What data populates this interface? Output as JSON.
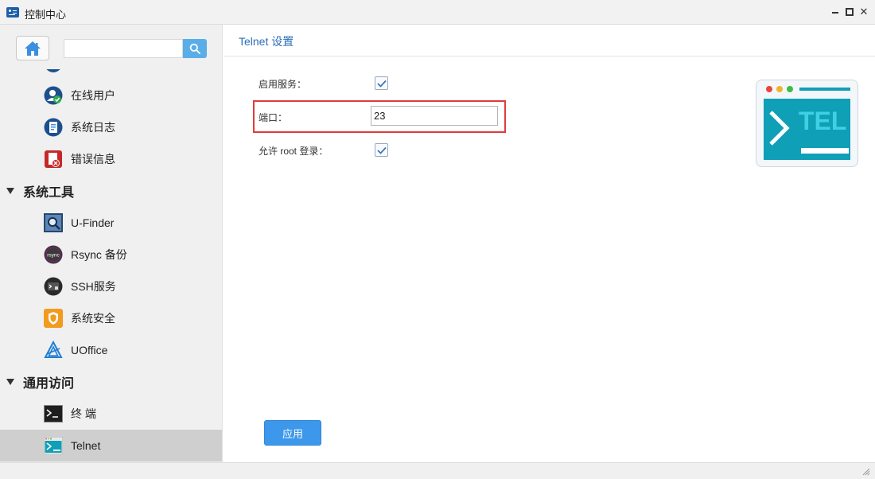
{
  "window": {
    "title": "控制中心",
    "app_icon": "control-center-icon"
  },
  "sidebar": {
    "home_icon": "home-icon",
    "search": {
      "value": "",
      "placeholder": ""
    },
    "items": [
      {
        "label": "",
        "icon": "user-partial-icon",
        "type": "item"
      },
      {
        "label": "在线用户",
        "icon": "online-user-icon",
        "type": "item"
      },
      {
        "label": "系统日志",
        "icon": "system-log-icon",
        "type": "item"
      },
      {
        "label": "错误信息",
        "icon": "error-info-icon",
        "type": "item"
      },
      {
        "label": "系统工具",
        "type": "group"
      },
      {
        "label": "U-Finder",
        "icon": "u-finder-icon",
        "type": "item"
      },
      {
        "label": "Rsync 备份",
        "icon": "rsync-icon",
        "type": "item"
      },
      {
        "label": "SSH服务",
        "icon": "ssh-icon",
        "type": "item"
      },
      {
        "label": "系统安全",
        "icon": "shield-icon",
        "type": "item"
      },
      {
        "label": "UOffice",
        "icon": "uoffice-icon",
        "type": "item"
      },
      {
        "label": "通用访问",
        "type": "group"
      },
      {
        "label": "终 端",
        "icon": "terminal-icon",
        "type": "item"
      },
      {
        "label": "Telnet",
        "icon": "telnet-icon",
        "type": "item",
        "active": true
      }
    ]
  },
  "main": {
    "title": "Telnet 设置",
    "fields": {
      "enable_service": {
        "label": "启用服务：",
        "checked": true
      },
      "port": {
        "label": "端口：",
        "value": "23"
      },
      "allow_root": {
        "label": "允许 root 登录：",
        "checked": true
      }
    },
    "illustration": {
      "text": "TEL",
      "icon": "telnet-illustration-icon"
    },
    "apply_label": "应用"
  },
  "colors": {
    "accent": "#3d97ea",
    "title_blue": "#2a6fb8",
    "highlight_red": "#e03c3c",
    "teal": "#0f9fb6",
    "active_bg": "#cfcfcf"
  }
}
